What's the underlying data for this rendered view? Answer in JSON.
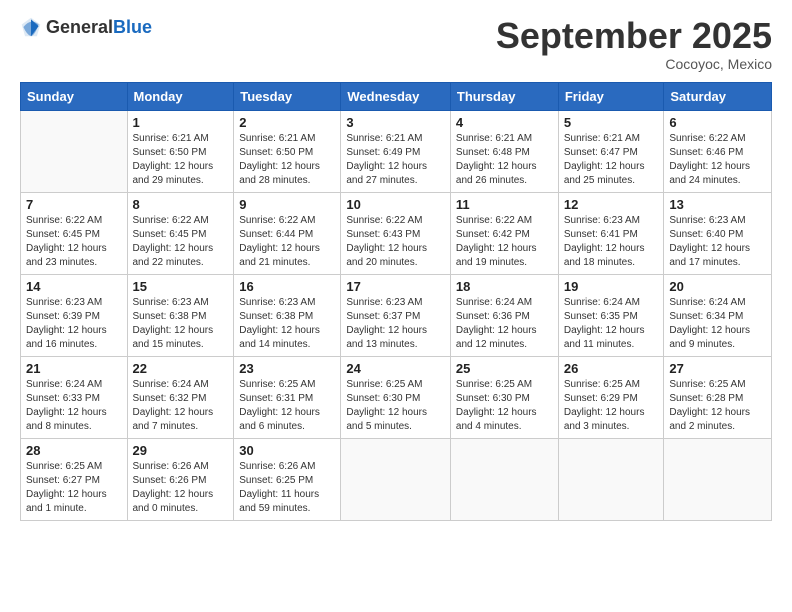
{
  "logo": {
    "general": "General",
    "blue": "Blue"
  },
  "header": {
    "month": "September 2025",
    "location": "Cocoyoc, Mexico"
  },
  "weekdays": [
    "Sunday",
    "Monday",
    "Tuesday",
    "Wednesday",
    "Thursday",
    "Friday",
    "Saturday"
  ],
  "weeks": [
    [
      {
        "day": "",
        "info": ""
      },
      {
        "day": "1",
        "info": "Sunrise: 6:21 AM\nSunset: 6:50 PM\nDaylight: 12 hours\nand 29 minutes."
      },
      {
        "day": "2",
        "info": "Sunrise: 6:21 AM\nSunset: 6:50 PM\nDaylight: 12 hours\nand 28 minutes."
      },
      {
        "day": "3",
        "info": "Sunrise: 6:21 AM\nSunset: 6:49 PM\nDaylight: 12 hours\nand 27 minutes."
      },
      {
        "day": "4",
        "info": "Sunrise: 6:21 AM\nSunset: 6:48 PM\nDaylight: 12 hours\nand 26 minutes."
      },
      {
        "day": "5",
        "info": "Sunrise: 6:21 AM\nSunset: 6:47 PM\nDaylight: 12 hours\nand 25 minutes."
      },
      {
        "day": "6",
        "info": "Sunrise: 6:22 AM\nSunset: 6:46 PM\nDaylight: 12 hours\nand 24 minutes."
      }
    ],
    [
      {
        "day": "7",
        "info": "Sunrise: 6:22 AM\nSunset: 6:45 PM\nDaylight: 12 hours\nand 23 minutes."
      },
      {
        "day": "8",
        "info": "Sunrise: 6:22 AM\nSunset: 6:45 PM\nDaylight: 12 hours\nand 22 minutes."
      },
      {
        "day": "9",
        "info": "Sunrise: 6:22 AM\nSunset: 6:44 PM\nDaylight: 12 hours\nand 21 minutes."
      },
      {
        "day": "10",
        "info": "Sunrise: 6:22 AM\nSunset: 6:43 PM\nDaylight: 12 hours\nand 20 minutes."
      },
      {
        "day": "11",
        "info": "Sunrise: 6:22 AM\nSunset: 6:42 PM\nDaylight: 12 hours\nand 19 minutes."
      },
      {
        "day": "12",
        "info": "Sunrise: 6:23 AM\nSunset: 6:41 PM\nDaylight: 12 hours\nand 18 minutes."
      },
      {
        "day": "13",
        "info": "Sunrise: 6:23 AM\nSunset: 6:40 PM\nDaylight: 12 hours\nand 17 minutes."
      }
    ],
    [
      {
        "day": "14",
        "info": "Sunrise: 6:23 AM\nSunset: 6:39 PM\nDaylight: 12 hours\nand 16 minutes."
      },
      {
        "day": "15",
        "info": "Sunrise: 6:23 AM\nSunset: 6:38 PM\nDaylight: 12 hours\nand 15 minutes."
      },
      {
        "day": "16",
        "info": "Sunrise: 6:23 AM\nSunset: 6:38 PM\nDaylight: 12 hours\nand 14 minutes."
      },
      {
        "day": "17",
        "info": "Sunrise: 6:23 AM\nSunset: 6:37 PM\nDaylight: 12 hours\nand 13 minutes."
      },
      {
        "day": "18",
        "info": "Sunrise: 6:24 AM\nSunset: 6:36 PM\nDaylight: 12 hours\nand 12 minutes."
      },
      {
        "day": "19",
        "info": "Sunrise: 6:24 AM\nSunset: 6:35 PM\nDaylight: 12 hours\nand 11 minutes."
      },
      {
        "day": "20",
        "info": "Sunrise: 6:24 AM\nSunset: 6:34 PM\nDaylight: 12 hours\nand 9 minutes."
      }
    ],
    [
      {
        "day": "21",
        "info": "Sunrise: 6:24 AM\nSunset: 6:33 PM\nDaylight: 12 hours\nand 8 minutes."
      },
      {
        "day": "22",
        "info": "Sunrise: 6:24 AM\nSunset: 6:32 PM\nDaylight: 12 hours\nand 7 minutes."
      },
      {
        "day": "23",
        "info": "Sunrise: 6:25 AM\nSunset: 6:31 PM\nDaylight: 12 hours\nand 6 minutes."
      },
      {
        "day": "24",
        "info": "Sunrise: 6:25 AM\nSunset: 6:30 PM\nDaylight: 12 hours\nand 5 minutes."
      },
      {
        "day": "25",
        "info": "Sunrise: 6:25 AM\nSunset: 6:30 PM\nDaylight: 12 hours\nand 4 minutes."
      },
      {
        "day": "26",
        "info": "Sunrise: 6:25 AM\nSunset: 6:29 PM\nDaylight: 12 hours\nand 3 minutes."
      },
      {
        "day": "27",
        "info": "Sunrise: 6:25 AM\nSunset: 6:28 PM\nDaylight: 12 hours\nand 2 minutes."
      }
    ],
    [
      {
        "day": "28",
        "info": "Sunrise: 6:25 AM\nSunset: 6:27 PM\nDaylight: 12 hours\nand 1 minute."
      },
      {
        "day": "29",
        "info": "Sunrise: 6:26 AM\nSunset: 6:26 PM\nDaylight: 12 hours\nand 0 minutes."
      },
      {
        "day": "30",
        "info": "Sunrise: 6:26 AM\nSunset: 6:25 PM\nDaylight: 11 hours\nand 59 minutes."
      },
      {
        "day": "",
        "info": ""
      },
      {
        "day": "",
        "info": ""
      },
      {
        "day": "",
        "info": ""
      },
      {
        "day": "",
        "info": ""
      }
    ]
  ]
}
